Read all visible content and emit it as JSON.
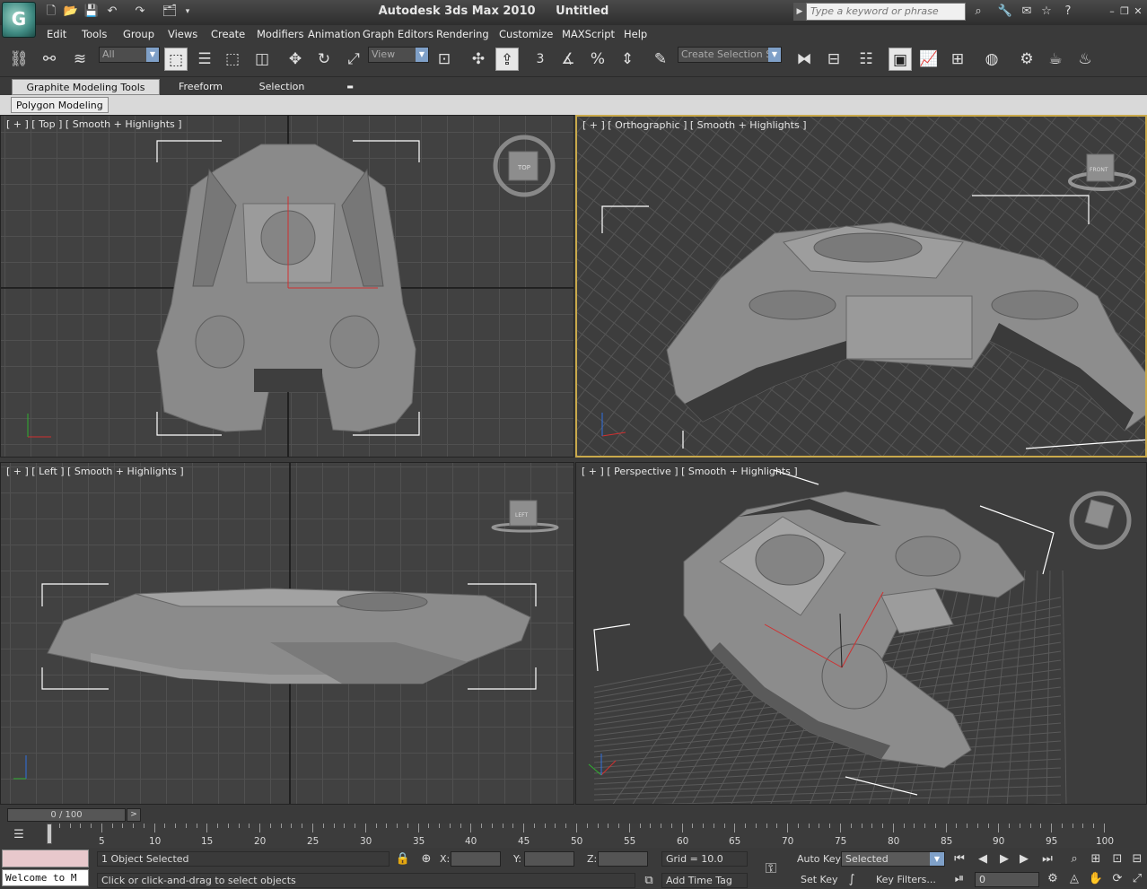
{
  "titlebar": {
    "app_name": "Autodesk 3ds Max  2010",
    "document": "Untitled",
    "logo": "G",
    "search_placeholder": "Type a keyword or phrase",
    "icons": [
      "new-icon",
      "open-icon",
      "save-icon",
      "undo-icon",
      "redo-icon",
      "project-folder-icon"
    ]
  },
  "menubar": {
    "items": [
      "Edit",
      "Tools",
      "Group",
      "Views",
      "Create",
      "Modifiers",
      "Animation",
      "Graph Editors",
      "Rendering",
      "Customize",
      "MAXScript",
      "Help"
    ]
  },
  "toolbar": {
    "selection_filter": "All",
    "reference_coord": "View",
    "named_selection": "Create Selection Se",
    "snap_label": "3"
  },
  "ribbon": {
    "tabs": [
      "Graphite Modeling Tools",
      "Freeform",
      "Selection"
    ],
    "active_tab": "Graphite Modeling Tools",
    "panel_button": "Polygon Modeling"
  },
  "viewports": {
    "top": {
      "label": "[ + ] [ Top ] [ Smooth + Highlights ]",
      "cube_label": "TOP"
    },
    "ortho": {
      "label": "[ + ] [ Orthographic ] [ Smooth + Highlights ]",
      "cube_label": "FRONT"
    },
    "left": {
      "label": "[ + ] [ Left ] [ Smooth + Highlights ]",
      "cube_label": "LEFT"
    },
    "perspective": {
      "label": "[ + ] [ Perspective ] [ Smooth + Highlights ]"
    }
  },
  "timeline": {
    "slider_text": "0 / 100",
    "tick_labels": [
      "5",
      "10",
      "15",
      "20",
      "25",
      "30",
      "35",
      "40",
      "45",
      "50",
      "55",
      "60",
      "65",
      "70",
      "75",
      "80",
      "85",
      "90",
      "95",
      "100"
    ]
  },
  "statusbar": {
    "maxscript_text": "Welcome to M",
    "selection_status": "1 Object Selected",
    "prompt": "Click or click-and-drag to select objects",
    "x_label": "X:",
    "y_label": "Y:",
    "z_label": "Z:",
    "grid": "Grid = 10.0",
    "add_time_tag": "Add Time Tag",
    "auto_key": "Auto Key",
    "set_key": "Set Key",
    "key_mode": "Selected",
    "key_filters": "Key Filters...",
    "frame": "0"
  },
  "colors": {
    "bg": "#3b3b3b",
    "viewport": "#3d3d3d",
    "active_border": "#c9a94b",
    "model": "#8a8a8a",
    "selection_bracket": "#ffffff",
    "axis_red": "#d03030"
  }
}
